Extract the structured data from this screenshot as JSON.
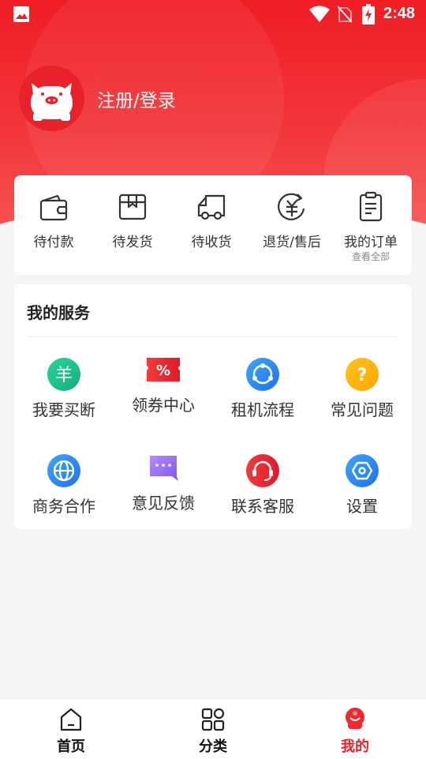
{
  "status_bar": {
    "time": "2:48"
  },
  "profile": {
    "login_label": "注册/登录"
  },
  "orders": {
    "items": [
      {
        "label": "待付款"
      },
      {
        "label": "待发货"
      },
      {
        "label": "待收货"
      },
      {
        "label": "退货/售后"
      },
      {
        "label": "我的订单",
        "sub": "查看全部"
      }
    ]
  },
  "services": {
    "title": "我的服务",
    "items": [
      {
        "label": "我要买断",
        "icon": "buyout-icon"
      },
      {
        "label": "领券中心",
        "icon": "coupon-icon"
      },
      {
        "label": "租机流程",
        "icon": "process-icon"
      },
      {
        "label": "常见问题",
        "icon": "faq-icon"
      },
      {
        "label": "商务合作",
        "icon": "globe-icon"
      },
      {
        "label": "意见反馈",
        "icon": "chat-icon"
      },
      {
        "label": "联系客服",
        "icon": "headset-icon"
      },
      {
        "label": "设置",
        "icon": "settings-icon"
      }
    ],
    "coupon_badge": "%",
    "buyout_symbol": "羊",
    "faq_symbol": "?"
  },
  "bottom_nav": {
    "tabs": [
      {
        "label": "首页"
      },
      {
        "label": "分类"
      },
      {
        "label": "我的"
      }
    ],
    "active_index": 2
  },
  "colors": {
    "brand_red": "#e8222a",
    "green": "#1fc38f",
    "blue": "#2f8df0",
    "yellow": "#ffb400",
    "purple": "#9b6ef3"
  }
}
